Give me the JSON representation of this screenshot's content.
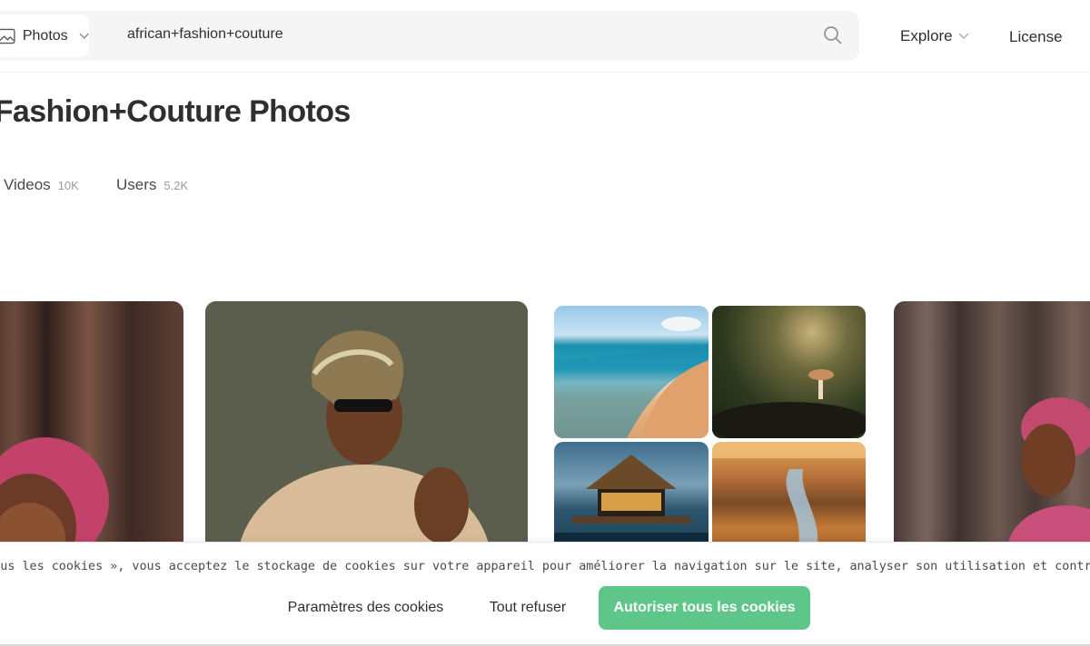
{
  "header": {
    "type_select_label": "Photos",
    "search_value": "african+fashion+couture",
    "nav": {
      "explore_label": "Explore",
      "license_label": "License"
    }
  },
  "page": {
    "title": "an+Fashion+Couture Photos"
  },
  "tabs": [
    {
      "label": "Videos",
      "count": "10K"
    },
    {
      "label": "Users",
      "count": "5.2K"
    }
  ],
  "cookie_banner": {
    "text": "er tous les cookies », vous acceptez le stockage de cookies sur votre appareil pour améliorer la navigation sur le site, analyser son utilisation et contribuer à nos efforts de marketing.",
    "settings_label": "Paramètres des cookies",
    "refuse_label": "Tout refuser",
    "accept_label": "Autoriser tous les cookies"
  },
  "colors": {
    "accent_green": "#5ec689",
    "search_bg": "#f5f5f5"
  },
  "icons": {
    "type_select": "image-icon",
    "search": "search-icon",
    "dropdown": "chevron-down-icon"
  }
}
